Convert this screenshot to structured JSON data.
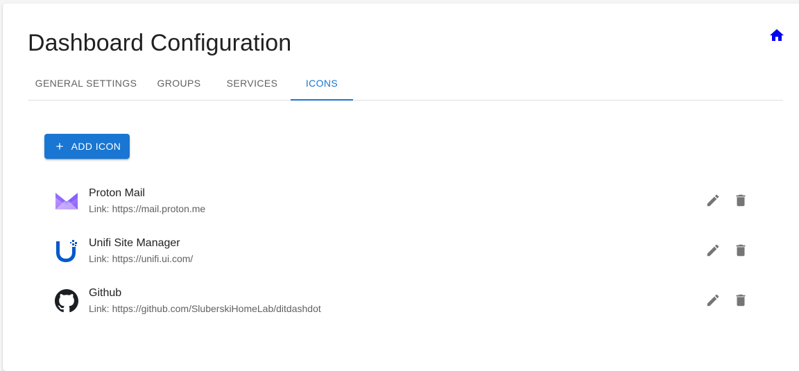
{
  "header": {
    "title": "Dashboard Configuration",
    "home_icon": "home-icon"
  },
  "tabs": [
    {
      "label": "GENERAL SETTINGS",
      "active": false
    },
    {
      "label": "GROUPS",
      "active": false
    },
    {
      "label": "SERVICES",
      "active": false
    },
    {
      "label": "ICONS",
      "active": true
    }
  ],
  "toolbar": {
    "add_label": "ADD ICON",
    "add_icon": "plus-icon"
  },
  "icons": [
    {
      "name": "Proton Mail",
      "link_prefix": "Link:",
      "link": "https://mail.proton.me",
      "logo": "proton-mail-icon"
    },
    {
      "name": "Unifi Site Manager",
      "link_prefix": "Link:",
      "link": "https://unifi.ui.com/",
      "logo": "unifi-icon"
    },
    {
      "name": "Github",
      "link_prefix": "Link:",
      "link": "https://github.com/SluberskiHomeLab/ditdashdot",
      "logo": "github-icon"
    }
  ],
  "colors": {
    "accent": "#1976d2",
    "home_icon": "#0000ee",
    "action_icon": "#757575",
    "proton_purple": "#8b6cf2",
    "unifi_blue": "#0559c9",
    "github_black": "#1b1f23"
  }
}
